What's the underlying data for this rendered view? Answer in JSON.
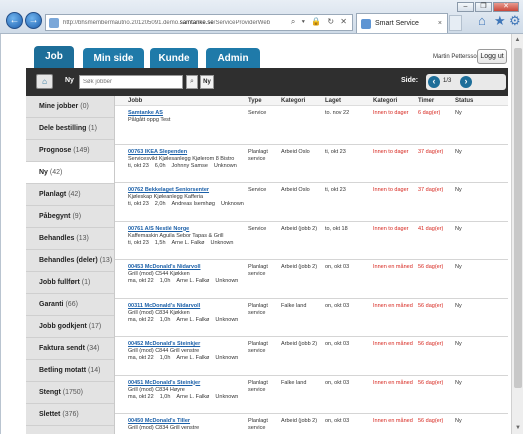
{
  "browser": {
    "url_prefix": "http://bhsmembermautno.201205091.demo.",
    "url_domain": "samtanke.se",
    "url_suffix": "/ServiceProviderWeb",
    "tab_title": "Smart Service",
    "minimize": "–",
    "restore": "❐",
    "close": "✕",
    "back": "←",
    "forward": "→",
    "url_tools": "⌕ ▾ 🔒 ↻ ✕",
    "tab_close": "×",
    "home_icon": "⌂",
    "star_icon": "★",
    "gear_icon": "⚙"
  },
  "header": {
    "tabs": [
      "Job",
      "Min side",
      "Kunde",
      "Admin"
    ],
    "user": "Martin Pettersson",
    "logout": "Logg ut"
  },
  "toolbar": {
    "home_icon": "⌂",
    "ny_label": "Ny",
    "search_placeholder": "Søk jobber",
    "search_icon": "⌕",
    "ny_button": "Ny",
    "page_label": "Side:",
    "page": "1/3",
    "prev": "‹",
    "next": "›"
  },
  "sidebar": [
    {
      "name": "Mine jobber",
      "count": "(0)"
    },
    {
      "name": "Dele bestilling",
      "count": "(1)"
    },
    {
      "name": "Prognose",
      "count": "(149)"
    },
    {
      "name": "Ny",
      "count": "(42)"
    },
    {
      "name": "Planlagt",
      "count": "(42)"
    },
    {
      "name": "Påbegynt",
      "count": "(9)"
    },
    {
      "name": "Behandles",
      "count": "(13)"
    },
    {
      "name": "Behandles (deler)",
      "count": "(13)"
    },
    {
      "name": "Jobb fullført",
      "count": "(1)"
    },
    {
      "name": "Garanti",
      "count": "(66)"
    },
    {
      "name": "Jobb godkjent",
      "count": "(17)"
    },
    {
      "name": "Faktura sendt",
      "count": "(34)"
    },
    {
      "name": "Betling motatt",
      "count": "(14)"
    },
    {
      "name": "Stengt",
      "count": "(1750)"
    },
    {
      "name": "Slettet",
      "count": "(376)"
    }
  ],
  "table": {
    "columns": [
      "Jobb",
      "Type",
      "Kategori",
      "Laget",
      "Kategori",
      "Timer",
      "Status"
    ],
    "rows": [
      {
        "link": "Samtanke AS",
        "desc": "Pålgått oppg Test",
        "meta": [
          "",
          "",
          "",
          ""
        ],
        "type": "Service",
        "kategori": "",
        "laget": "to. nov 22",
        "kat2": "Innen to dager",
        "timer": "6 dag(er)",
        "status": "Ny"
      },
      {
        "link": "00763 IKEA Slependen",
        "desc": "Servicesvikt Kjølesanlegg Kjølerom 8 Bistro",
        "meta": [
          "ti, okt 23",
          "6,0h",
          "Johnny Samse",
          "Unknown"
        ],
        "type": "Planlagt service",
        "kategori": "Arbeid Oslo",
        "laget": "ti, okt 23",
        "kat2": "Innen to dager",
        "timer": "37 dag(er)",
        "status": "Ny"
      },
      {
        "link": "00762 Bekkelaget Seniorsenter",
        "desc": "Kjøleskap Kjøleanlegg Kafferia",
        "meta": [
          "ti, okt 23",
          "2,0h",
          "Andreas Isemhøg",
          "Unknown"
        ],
        "type": "Service",
        "kategori": "Arbeid Oslo",
        "laget": "ti, okt 23",
        "kat2": "Innen to dager",
        "timer": "37 dag(er)",
        "status": "Ny"
      },
      {
        "link": "00761 A/S Nestlé Norge",
        "desc": "Kaffemaskin Aguila Sebor Tapas & Grill",
        "meta": [
          "ti, okt 23",
          "1,5h",
          "Arne L. Falkø",
          "Unknown"
        ],
        "type": "Service",
        "kategori": "Arbeid (jobb 2)",
        "laget": "to, okt 18",
        "kat2": "Innen to dager",
        "timer": "41 dag(er)",
        "status": "Ny"
      },
      {
        "link": "00453 McDonald's Nidarvoll",
        "desc": "Grill (mod) C544 Kjøkken",
        "meta": [
          "ma, okt 22",
          "1,0h",
          "Arne L. Falkø",
          "Unknown"
        ],
        "type": "Planlagt service",
        "kategori": "Arbeid (jobb 2)",
        "laget": "on, okt 03",
        "kat2": "Innen en måned",
        "timer": "56 dag(er)",
        "status": "Ny"
      },
      {
        "link": "00311 McDonald's Nidarvoll",
        "desc": "Grill (mod) C834 Kjøkken",
        "meta": [
          "ma, okt 22",
          "1,0h",
          "Arne L. Falkø",
          "Unknown"
        ],
        "type": "Planlagt service",
        "kategori": "Falke land",
        "laget": "on, okt 03",
        "kat2": "Innen en måned",
        "timer": "56 dag(er)",
        "status": "Ny"
      },
      {
        "link": "00452 McDonald's Steinkjer",
        "desc": "Grill (mod) C844 Grill venstre",
        "meta": [
          "ma, okt 22",
          "1,0h",
          "Arne L. Falkø",
          "Unknown"
        ],
        "type": "Planlagt service",
        "kategori": "Arbeid (jobb 2)",
        "laget": "on, okt 03",
        "kat2": "Innen en måned",
        "timer": "56 dag(er)",
        "status": "Ny"
      },
      {
        "link": "00451 McDonald's Steinkjer",
        "desc": "Grill (mod) C834 Høyre",
        "meta": [
          "ma, okt 22",
          "1,0h",
          "Arne L. Falkø",
          "Unknown"
        ],
        "type": "Planlagt service",
        "kategori": "Falke land",
        "laget": "on, okt 03",
        "kat2": "Innen en måned",
        "timer": "56 dag(er)",
        "status": "Ny"
      },
      {
        "link": "00450 McDonald's Tiller",
        "desc": "Grill (mod) C834 Grill venstre",
        "meta": [
          "",
          "",
          "",
          ""
        ],
        "type": "Planlagt service",
        "kategori": "Arbeid (jobb 2)",
        "laget": "on, okt 03",
        "kat2": "Innen en måned",
        "timer": "56 dag(er)",
        "status": "Ny"
      }
    ]
  }
}
